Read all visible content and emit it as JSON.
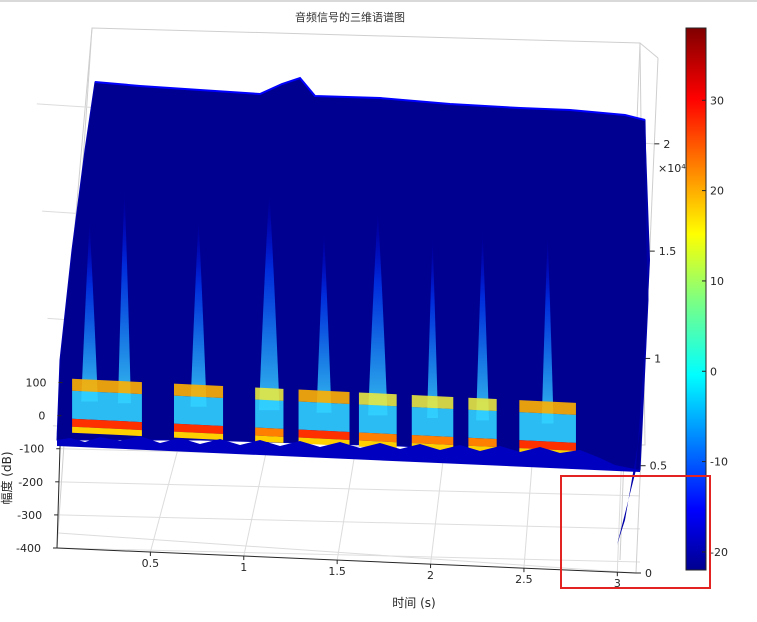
{
  "chart_data": {
    "type": "heatmap",
    "subtype": "3d-spectrogram",
    "title": "音频信号的三维语谱图",
    "xlabel": "时间 (s)",
    "ylabel": "",
    "zlabel": "幅度 (dB)",
    "x_ticks": [
      "0.5",
      "1",
      "1.5",
      "2",
      "2.5",
      "3"
    ],
    "y_ticks": [
      "0",
      "0.5",
      "1",
      "1.5",
      "2"
    ],
    "y_exponent_label": "×10⁴",
    "z_ticks": [
      "100",
      "0",
      "-100",
      "-200",
      "-300",
      "-400"
    ],
    "colorbar_ticks": [
      "30",
      "20",
      "10",
      "0",
      "-10",
      "-20"
    ],
    "xlim": [
      0,
      3.1
    ],
    "ylim": [
      0,
      2.4
    ],
    "zlim": [
      -400,
      150
    ],
    "clim": [
      -22,
      38
    ],
    "colormap": "jet",
    "grid": true,
    "segments": [
      {
        "x": [
          0.08,
          0.45
        ],
        "hot": 0.9
      },
      {
        "x": [
          0.62,
          0.88
        ],
        "hot": 0.85
      },
      {
        "x": [
          1.05,
          1.2
        ],
        "hot": 0.75
      },
      {
        "x": [
          1.28,
          1.55
        ],
        "hot": 0.85
      },
      {
        "x": [
          1.6,
          1.8
        ],
        "hot": 0.7
      },
      {
        "x": [
          1.88,
          2.1
        ],
        "hot": 0.8
      },
      {
        "x": [
          2.18,
          2.33
        ],
        "hot": 0.6
      },
      {
        "x": [
          2.45,
          2.75
        ],
        "hot": 0.9
      }
    ]
  },
  "colors": {
    "axis": "#262626",
    "grid": "#d0d0d0",
    "floor": "#ffffff",
    "highlight": "#e32222",
    "background": "#000080"
  }
}
